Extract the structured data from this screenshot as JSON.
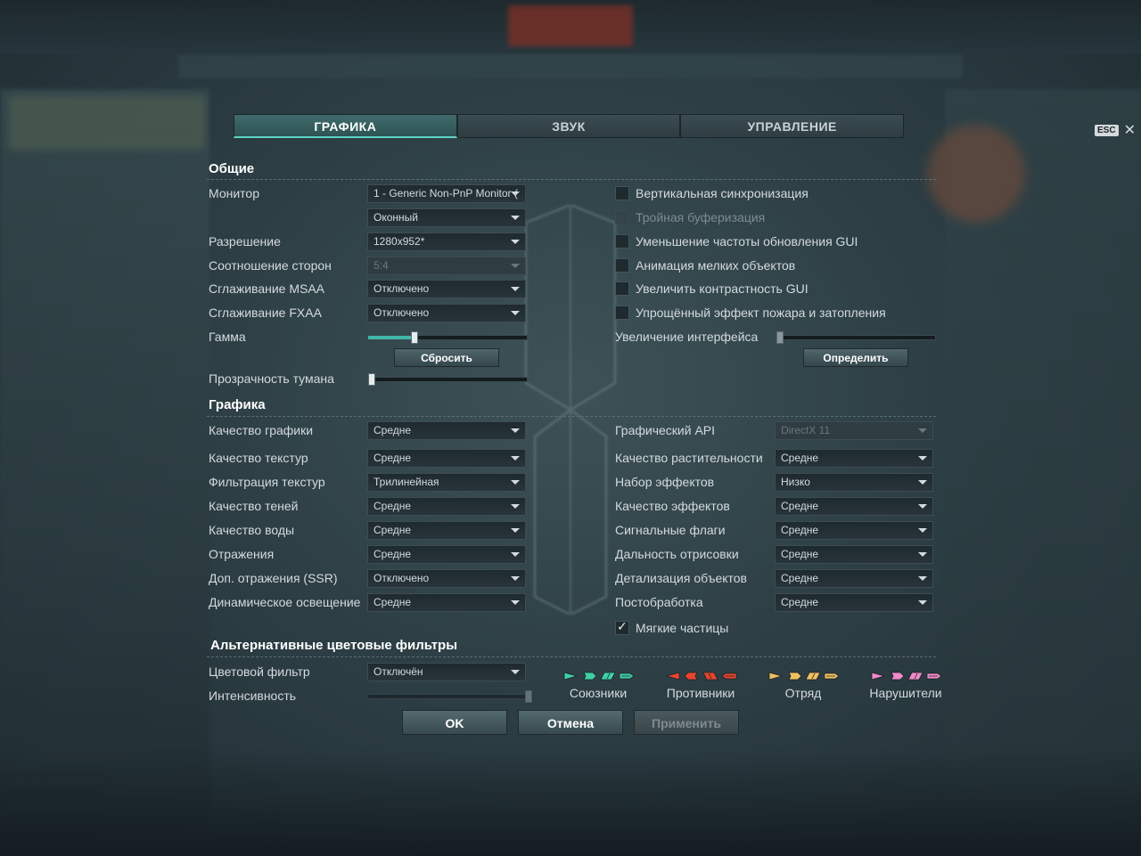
{
  "tabs": [
    {
      "label": "ГРАФИКА",
      "active": true
    },
    {
      "label": "ЗВУК",
      "active": false
    },
    {
      "label": "УПРАВЛЕНИЕ",
      "active": false
    }
  ],
  "esc": {
    "key": "ESC",
    "close": "✕"
  },
  "general": {
    "title": "Общие",
    "monitor_label": "Монитор",
    "monitor_value": "1 - Generic Non-PnP Monitor (",
    "window_mode_value": "Оконный",
    "resolution_label": "Разрешение",
    "resolution_value": "1280x952*",
    "aspect_label": "Соотношение сторон",
    "aspect_value": "5:4",
    "msaa_label": "Сглаживание MSAA",
    "msaa_value": "Отключено",
    "fxaa_label": "Сглаживание FXAA",
    "fxaa_value": "Отключено",
    "gamma_label": "Гамма",
    "gamma_level": 0.28,
    "reset_button": "Сбросить",
    "fog_label": "Прозрачность тумана",
    "fog_level": 0.0,
    "vsync_label": "Вертикальная синхронизация",
    "triple_buffer_label": "Тройная буферизация",
    "gui_refresh_label": "Уменьшение частоты обновления GUI",
    "small_anim_label": "Анимация мелких объектов",
    "gui_contrast_label": "Увеличить контрастность GUI",
    "fire_effect_label": "Упрощённый эффект пожара и затопления",
    "ui_scale_label": "Увеличение интерфейса",
    "ui_scale_level": 0.0,
    "detect_button": "Определить"
  },
  "graphics": {
    "title": "Графика",
    "left": [
      {
        "label": "Качество графики",
        "value": "Средне"
      },
      {
        "label": "Качество текстур",
        "value": "Средне"
      },
      {
        "label": "Фильтрация текстур",
        "value": "Трилинейная"
      },
      {
        "label": "Качество теней",
        "value": "Средне"
      },
      {
        "label": "Качество воды",
        "value": "Средне"
      },
      {
        "label": "Отражения",
        "value": "Средне"
      },
      {
        "label": "Доп. отражения (SSR)",
        "value": "Отключено"
      },
      {
        "label": "Динамическое освещение",
        "value": "Средне"
      }
    ],
    "right": [
      {
        "label": "Графический API",
        "value": "DirectX 11"
      },
      {
        "label": "Качество растительности",
        "value": "Средне"
      },
      {
        "label": "Набор эффектов",
        "value": "Низко"
      },
      {
        "label": "Качество эффектов",
        "value": "Средне"
      },
      {
        "label": "Сигнальные флаги",
        "value": "Средне"
      },
      {
        "label": "Дальность отрисовки",
        "value": "Средне"
      },
      {
        "label": "Детализация объектов",
        "value": "Средне"
      },
      {
        "label": "Постобработка",
        "value": "Средне"
      }
    ],
    "soft_particles_label": "Мягкие частицы"
  },
  "color_filters": {
    "title": "Альтернативные цветовые фильтры",
    "filter_label": "Цветовой фильтр",
    "filter_value": "Отключён",
    "intensity_label": "Интенсивность",
    "intensity_level": 1.0,
    "legend": [
      {
        "name": "Союзники",
        "color": "#3fd0a8"
      },
      {
        "name": "Противники",
        "color": "#e8442e"
      },
      {
        "name": "Отряд",
        "color": "#f0c060"
      },
      {
        "name": "Нарушители",
        "color": "#f08ac8"
      }
    ]
  },
  "actions": {
    "ok": "OK",
    "cancel": "Отмена",
    "apply": "Применить"
  }
}
